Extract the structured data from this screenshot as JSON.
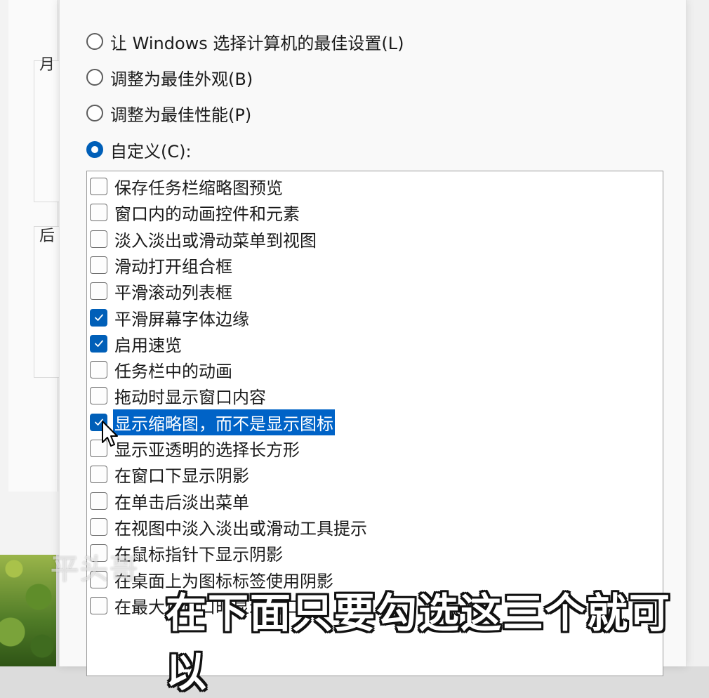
{
  "background": {
    "chars": [
      "月",
      "后"
    ]
  },
  "dialog": {
    "radios": [
      {
        "label": "让 Windows 选择计算机的最佳设置(L)",
        "selected": false
      },
      {
        "label": "调整为最佳外观(B)",
        "selected": false
      },
      {
        "label": "调整为最佳性能(P)",
        "selected": false
      },
      {
        "label": "自定义(C):",
        "selected": true
      }
    ],
    "options": [
      {
        "label": "保存任务栏缩略图预览",
        "checked": false
      },
      {
        "label": "窗口内的动画控件和元素",
        "checked": false
      },
      {
        "label": "淡入淡出或滑动菜单到视图",
        "checked": false
      },
      {
        "label": "滑动打开组合框",
        "checked": false
      },
      {
        "label": "平滑滚动列表框",
        "checked": false
      },
      {
        "label": "平滑屏幕字体边缘",
        "checked": true
      },
      {
        "label": "启用速览",
        "checked": true
      },
      {
        "label": "任务栏中的动画",
        "checked": false
      },
      {
        "label": "拖动时显示窗口内容",
        "checked": false
      },
      {
        "label": "显示缩略图，而不是显示图标",
        "checked": true,
        "highlighted": true
      },
      {
        "label": "显示亚透明的选择长方形",
        "checked": false
      },
      {
        "label": "在窗口下显示阴影",
        "checked": false
      },
      {
        "label": "在单击后淡出菜单",
        "checked": false
      },
      {
        "label": "在视图中淡入淡出或滑动工具提示",
        "checked": false
      },
      {
        "label": "在鼠标指针下显示阴影",
        "checked": false
      },
      {
        "label": "在桌面上为图标标签使用阴影",
        "checked": false
      },
      {
        "label": "在最大化窗口时显示窗口",
        "checked": false
      }
    ]
  },
  "overlay": {
    "watermark": "平头哥",
    "subtitle": "在下面只要勾选这三个就可以"
  },
  "colors": {
    "accent": "#005fb8",
    "selection": "#0063c7"
  }
}
